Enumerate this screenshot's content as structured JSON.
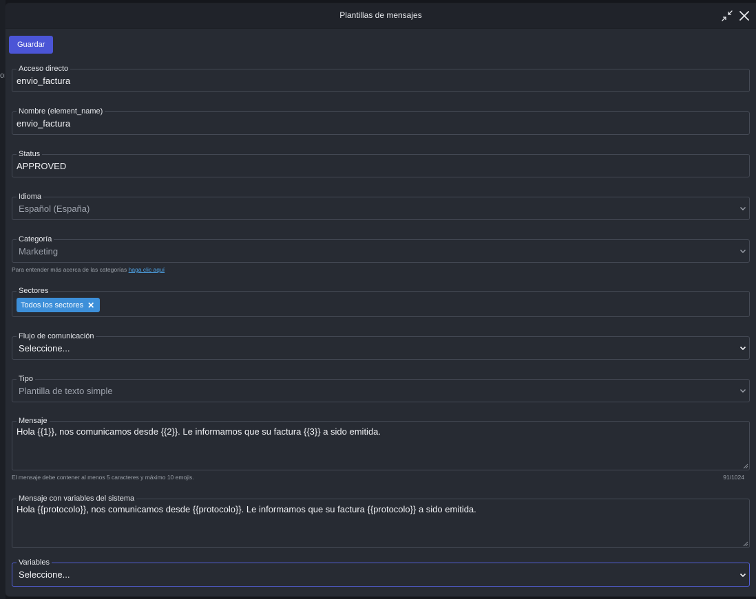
{
  "backdrop": {
    "snippet": "on"
  },
  "modal": {
    "title": "Plantillas de mensajes",
    "save_label": "Guardar"
  },
  "fields": {
    "acceso_directo": {
      "label": "Acceso directo",
      "value": "envio_factura"
    },
    "nombre": {
      "label": "Nombre (element_name)",
      "value": "envio_factura"
    },
    "status": {
      "label": "Status",
      "value": "APPROVED"
    },
    "idioma": {
      "label": "Idioma",
      "value": "Español (España)"
    },
    "categoria": {
      "label": "Categoría",
      "value": "Marketing",
      "help_text": "Para entender más acerca de las categorías ",
      "help_link": "haga clic aquí"
    },
    "sectores": {
      "label": "Sectores",
      "chip": "Todos los sectores"
    },
    "flujo": {
      "label": "Flujo de comunicación",
      "value": "Seleccione..."
    },
    "tipo": {
      "label": "Tipo",
      "value": "Plantilla de texto simple"
    },
    "mensaje": {
      "label": "Mensaje",
      "value": "Hola {{1}}, nos comunicamos desde {{2}}. Le informamos que su factura {{3}} a sido emitida.",
      "help_text": "El mensaje debe contener al menos 5 caracteres y máximo 10 emojis.",
      "counter": "91/1024"
    },
    "mensaje_sistema": {
      "label": "Mensaje con variables del sistema",
      "value": "Hola {{protocolo}}, nos comunicamos desde {{protocolo}}. Le informamos que su factura {{protocolo}} a sido emitida."
    },
    "variables": {
      "label": "Variables",
      "value": "Seleccione..."
    }
  },
  "icons": {
    "compress": "compress-icon",
    "close": "close-icon",
    "chevron": "chevron-down-icon",
    "chip_remove": "remove-chip-icon"
  },
  "colors": {
    "accent": "#4b55d6",
    "chip": "#3d8fd9",
    "link": "#4ea3e6",
    "panel": "#272b33"
  }
}
